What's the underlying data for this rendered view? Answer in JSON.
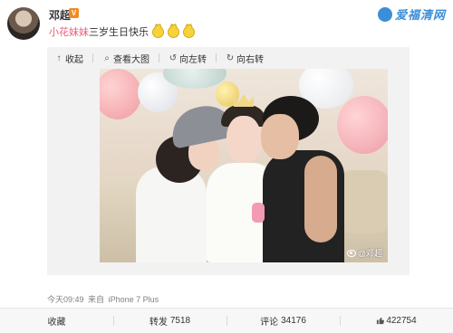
{
  "header": {
    "username": "邓超",
    "vip_badge": "V",
    "watermark": "爱福清网"
  },
  "post": {
    "mention": "小花妹妹",
    "text": "三岁生日快乐",
    "emoji_icons": [
      "cat-face-icon",
      "cat-face-icon",
      "cat-face-icon"
    ]
  },
  "toolbar": {
    "collapse": "收起",
    "view_large": "查看大图",
    "rotate_left": "向左转",
    "rotate_right": "向右转"
  },
  "photo": {
    "watermark": "@邓超"
  },
  "meta": {
    "time": "今天09:49",
    "source_prefix": "来自",
    "device": "iPhone 7 Plus"
  },
  "actions": {
    "favorite": "收藏",
    "repost_label": "转发",
    "repost_count": "7518",
    "comment_label": "评论",
    "comment_count": "34176",
    "like_count": "422754"
  }
}
